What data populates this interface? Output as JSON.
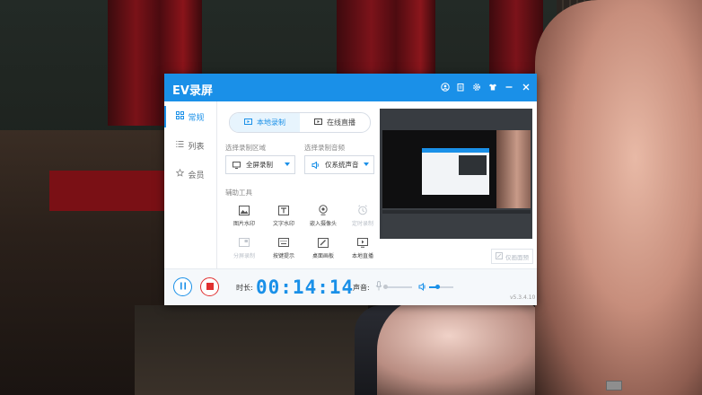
{
  "app": {
    "title": "EV录屏",
    "accent": "#1a90e8",
    "titlebar_icons": [
      "user-icon",
      "clipboard-icon",
      "gear-icon",
      "skin-icon",
      "minimize-icon",
      "close-icon"
    ]
  },
  "sidebar": {
    "items": [
      {
        "label": "常规",
        "icon": "grid-icon",
        "active": true
      },
      {
        "label": "列表",
        "icon": "list-icon",
        "active": false
      },
      {
        "label": "会员",
        "icon": "star-icon",
        "active": false
      }
    ]
  },
  "mode_tabs": [
    {
      "label": "本地录制",
      "icon": "record-screen-icon",
      "active": true
    },
    {
      "label": "在线直播",
      "icon": "play-screen-icon",
      "active": false
    }
  ],
  "area": {
    "label": "选择录制区域",
    "value": "全屏录制"
  },
  "audio": {
    "label": "选择录制音频",
    "value": "仅系统声音"
  },
  "tools": {
    "label": "辅助工具",
    "items": [
      {
        "label": "图片水印",
        "icon": "image-icon",
        "enabled": true
      },
      {
        "label": "文字水印",
        "icon": "text-icon",
        "enabled": true
      },
      {
        "label": "嵌入摄像头",
        "icon": "camera-icon",
        "enabled": true
      },
      {
        "label": "定时录制",
        "icon": "alarm-icon",
        "enabled": false
      },
      {
        "label": "分屏录制",
        "icon": "split-screen-icon",
        "enabled": false
      },
      {
        "label": "按键提示",
        "icon": "keyboard-icon",
        "enabled": true
      },
      {
        "label": "桌面画板",
        "icon": "pen-board-icon",
        "enabled": true
      },
      {
        "label": "本地直播",
        "icon": "monitor-play-icon",
        "enabled": true
      }
    ]
  },
  "preview_button": "仅画面预",
  "bottom": {
    "duration_label": "时长:",
    "timer": "00:14:14",
    "volume_label": "声音:",
    "version": "v5.3.4.10",
    "mic_level": 0,
    "speaker_level": 0.35
  }
}
